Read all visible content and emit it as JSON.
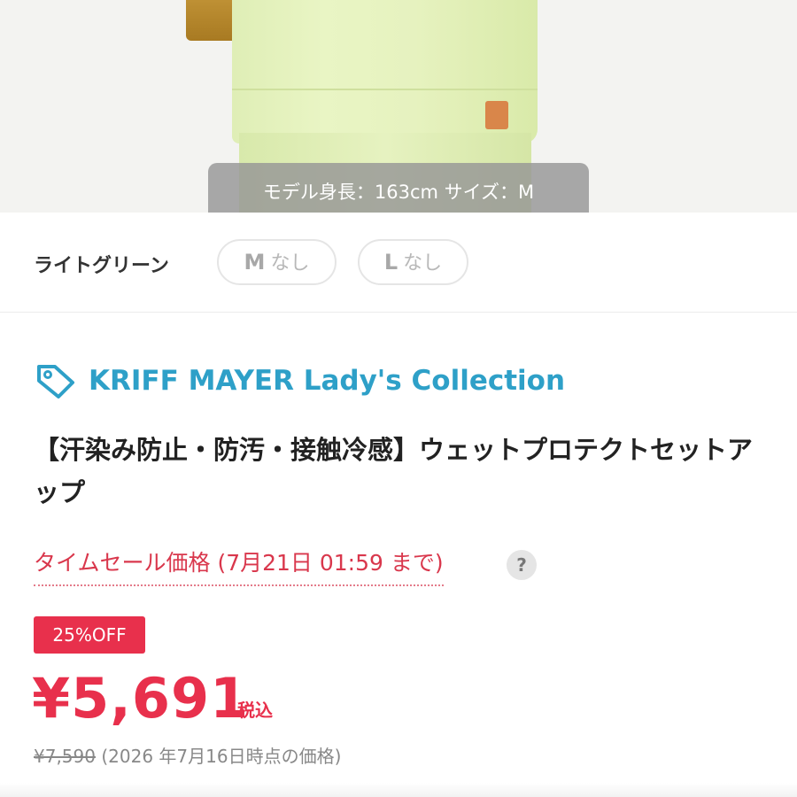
{
  "photo": {
    "caption": "モデル身長：163cm サイズ：M"
  },
  "variant": {
    "color_name": "ライトグリーン",
    "sizes": [
      {
        "size": "M",
        "status": "なし"
      },
      {
        "size": "L",
        "status": "なし"
      }
    ]
  },
  "brand": {
    "icon": "tag-icon",
    "name": "KRIFF MAYER Lady's Collection",
    "color": "#2ea0c8"
  },
  "product": {
    "title": "【汗染み防止・防汚・接触冷感】ウェットプロテクトセットアップ"
  },
  "pricing": {
    "sale_label": "タイムセール価格 (7月21日 01:59 まで)",
    "help_icon": "?",
    "discount_badge": "25%OFF",
    "price": "¥5,691",
    "tax_label": "税込",
    "original_price": "¥7,590",
    "original_note": "(2026 年7月16日時点の価格)",
    "accent_color": "#e8304c"
  }
}
